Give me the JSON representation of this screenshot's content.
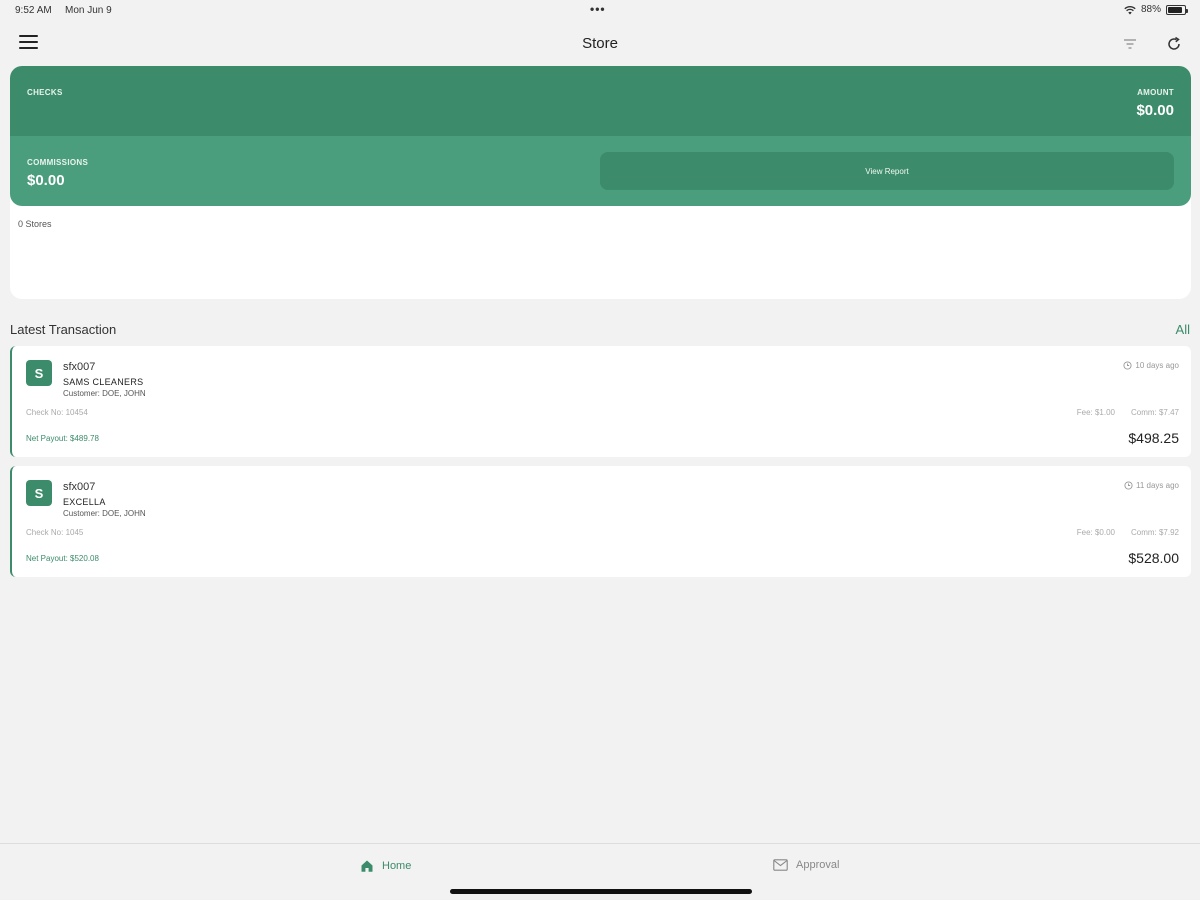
{
  "status_bar": {
    "time": "9:52 AM",
    "date": "Mon Jun 9",
    "dots": "•••",
    "battery": "88%"
  },
  "nav": {
    "title": "Store",
    "icons": [
      "menu-icon",
      "filter-icon",
      "refresh-icon"
    ]
  },
  "summary": {
    "checks_label": "CHECKS",
    "amount_label": "AMOUNT",
    "amount_value": "$0.00",
    "commissions_label": "COMMISSIONS",
    "commissions_value": "$0.00",
    "view_report": "View Report",
    "stores_count": "0 Stores"
  },
  "latest": {
    "title": "Latest Transaction",
    "all_link": "All",
    "transactions": [
      {
        "badge": "S",
        "user": "sfx007",
        "store": "SAMS CLEANERS",
        "customer": "Customer: DOE, JOHN",
        "ago": "10 days ago",
        "check": "Check No: 10454",
        "fee": "Fee: $1.00",
        "comm": "Comm: $7.47",
        "payout": "Net Payout: $489.78",
        "total": "$498.25"
      },
      {
        "badge": "S",
        "user": "sfx007",
        "store": "EXCELLA",
        "customer": "Customer: DOE, JOHN",
        "ago": "11 days ago",
        "check": "Check No: 1045",
        "fee": "Fee: $0.00",
        "comm": "Comm: $7.92",
        "payout": "Net Payout: $520.08",
        "total": "$528.00"
      }
    ]
  },
  "tabs": {
    "home": "Home",
    "approval": "Approval"
  },
  "colors": {
    "accent": "#3c8b6a",
    "accent_light": "#4a9d7d",
    "background": "#f2f2f2"
  }
}
